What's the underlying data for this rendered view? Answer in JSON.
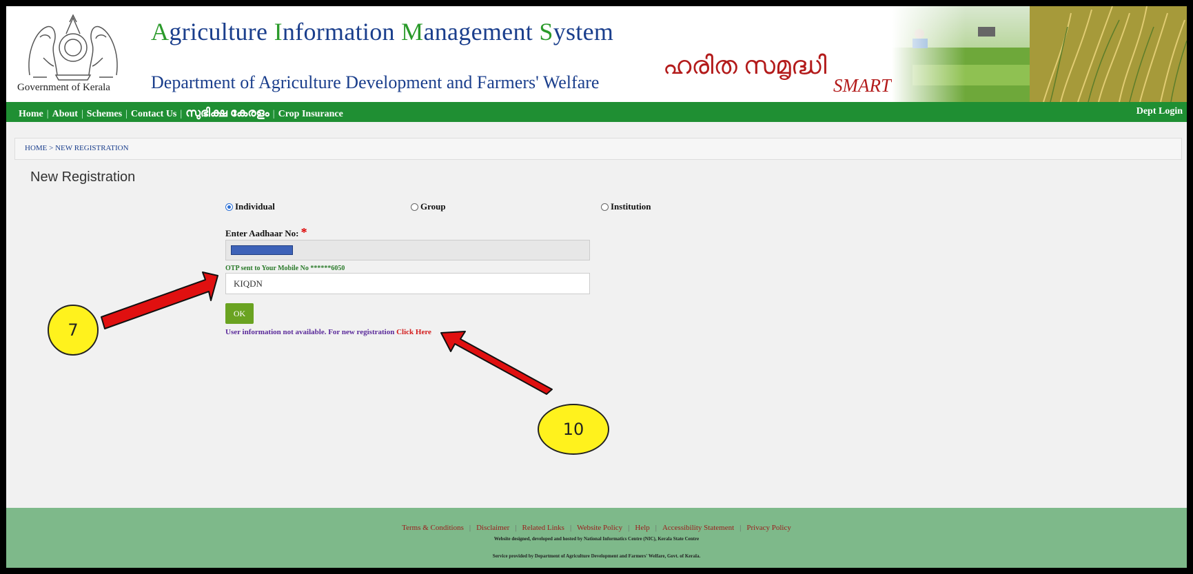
{
  "header": {
    "gov_label": "Government of Kerala",
    "title_parts": [
      "A",
      "griculture ",
      "I",
      "nformation ",
      "M",
      "anagement ",
      "S",
      "ystem"
    ],
    "subtitle": "Department of Agriculture Development and Farmers' Welfare",
    "malayalam_logo": "ഹരിത സമൃദ്ധി",
    "smart_label": "SMART"
  },
  "nav": {
    "items": [
      "Home",
      "About",
      "Schemes",
      "Contact Us",
      "സുഭിക്ഷ കേരളം",
      "Crop Insurance"
    ],
    "dept_login": "Dept Login"
  },
  "breadcrumb": "HOME > NEW REGISTRATION",
  "page_title": "New Registration",
  "form": {
    "radio_options": [
      {
        "label": "Individual",
        "checked": true
      },
      {
        "label": "Group",
        "checked": false
      },
      {
        "label": "Institution",
        "checked": false
      }
    ],
    "aadhaar_label": "Enter Aadhaar No:",
    "required_mark": "*",
    "otp_note": "OTP sent to Your Mobile No ******6050",
    "otp_value": "KIQDN",
    "ok_label": "OK",
    "info_text": "User information not available. For new registration ",
    "click_here": "Click Here"
  },
  "annotations": {
    "callout_7": "7",
    "callout_10": "10"
  },
  "footer": {
    "links": [
      "Terms & Conditions",
      "Disclaimer",
      "Related Links",
      "Website Policy",
      "Help",
      "Accessibility Statement",
      "Privacy Policy"
    ],
    "credit": "Website designed, developed and hosted by National Informatics Centre (NIC), Kerala State Centre",
    "service": "Service provided by Department of Agriculture Development and Farmers' Welfare, Govt. of Kerala."
  },
  "colors": {
    "nav_green": "#1f8f33",
    "title_blue": "#1a3e8c",
    "title_green": "#2a9a2a",
    "footer_green": "#7eb98a",
    "ok_green": "#6aa321",
    "annotation_red": "#e01010",
    "callout_yellow": "#fff21d"
  }
}
